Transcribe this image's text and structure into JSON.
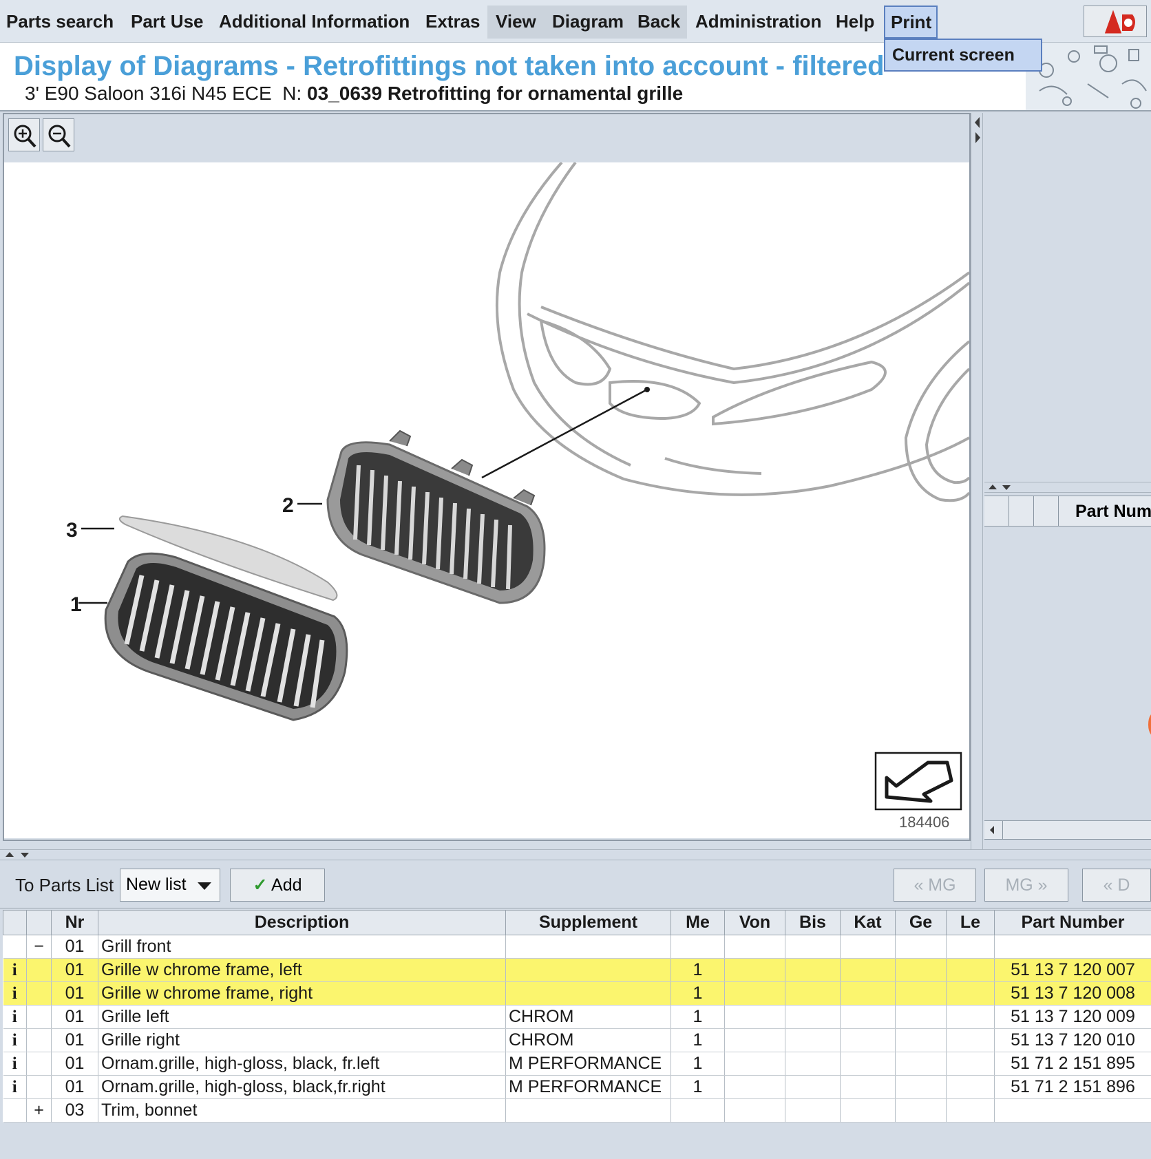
{
  "menu": {
    "items": [
      "Parts search",
      "Part Use",
      "Additional Information",
      "Extras",
      "View",
      "Diagram",
      "Back",
      "Administration",
      "Help"
    ],
    "print": "Print",
    "print_dropdown": "Current screen"
  },
  "header": {
    "title": "Display of Diagrams - Retrofittings not taken into account - filtered",
    "vehicle": "3' E90 Saloon 316i N45 ECE",
    "group_prefix": "N:",
    "group": "03_0639 Retrofitting for ornamental grille"
  },
  "diagram": {
    "callouts": [
      "1",
      "2",
      "3"
    ],
    "image_number": "184406"
  },
  "right_panel": {
    "column_title": "Part Num"
  },
  "parts_toolbar": {
    "to_parts_list": "To Parts List",
    "list_select": "New list",
    "add": "Add",
    "prev_mg": "« MG",
    "next_mg": "MG »",
    "prev_d": "« D"
  },
  "table": {
    "columns": [
      "Nr",
      "Description",
      "Supplement",
      "Me",
      "Von",
      "Bis",
      "Kat",
      "Ge",
      "Le",
      "Part Number"
    ],
    "rows": [
      {
        "info": "",
        "ctl": "−",
        "nr": "01",
        "desc": "Grill front",
        "supp": "",
        "me": "",
        "pn": "",
        "highlight": false
      },
      {
        "info": "i",
        "ctl": "",
        "nr": "01",
        "desc": "Grille w chrome frame, left",
        "supp": "",
        "me": "1",
        "pn": "51 13 7 120 007",
        "highlight": true
      },
      {
        "info": "i",
        "ctl": "",
        "nr": "01",
        "desc": "Grille w chrome frame, right",
        "supp": "",
        "me": "1",
        "pn": "51 13 7 120 008",
        "highlight": true
      },
      {
        "info": "i",
        "ctl": "",
        "nr": "01",
        "desc": "Grille left",
        "supp": "CHROM",
        "me": "1",
        "pn": "51 13 7 120 009",
        "highlight": false
      },
      {
        "info": "i",
        "ctl": "",
        "nr": "01",
        "desc": "Grille right",
        "supp": "CHROM",
        "me": "1",
        "pn": "51 13 7 120 010",
        "highlight": false
      },
      {
        "info": "i",
        "ctl": "",
        "nr": "01",
        "desc": "Ornam.grille, high-gloss, black, fr.left",
        "supp": "M PERFORMANCE",
        "me": "1",
        "pn": "51 71 2 151 895",
        "highlight": false
      },
      {
        "info": "i",
        "ctl": "",
        "nr": "01",
        "desc": "Ornam.grille, high-gloss, black,fr.right",
        "supp": "M PERFORMANCE",
        "me": "1",
        "pn": "51 71 2 151 896",
        "highlight": false
      },
      {
        "info": "",
        "ctl": "+",
        "nr": "03",
        "desc": "Trim, bonnet",
        "supp": "",
        "me": "",
        "pn": "",
        "highlight": false
      }
    ]
  },
  "colors": {
    "title_blue": "#4a9fd8",
    "highlight_yellow": "#fbf56e",
    "info_red": "#c0302a",
    "panel_gray": "#d4dce6"
  }
}
